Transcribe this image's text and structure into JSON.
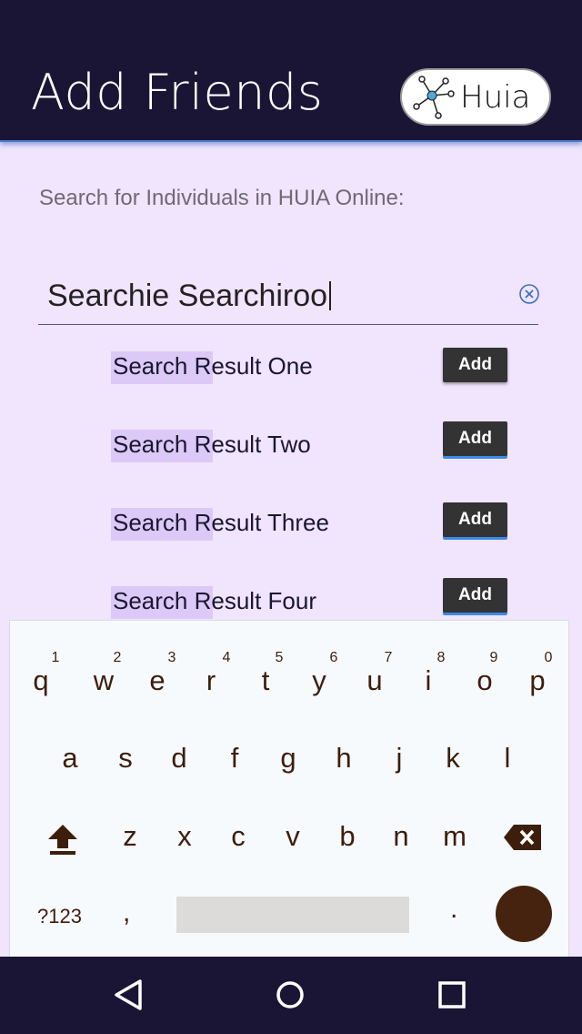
{
  "header": {
    "title": "Add Friends",
    "brand_name": "Huia"
  },
  "prompt": "Search for Individuals in HUIA Online:",
  "search": {
    "value": "Searchie Searchiroo"
  },
  "results": [
    {
      "highlight": "Search R",
      "label": "Search Result One",
      "button": "Add"
    },
    {
      "highlight": "Search R",
      "label": "Search Result Two",
      "button": "Add"
    },
    {
      "highlight": "Search R",
      "label": "Search Result Three",
      "button": "Add"
    },
    {
      "highlight": "Search R",
      "label": "Search Result Four",
      "button": "Add"
    }
  ],
  "keyboard": {
    "row1": [
      "q",
      "w",
      "e",
      "r",
      "t",
      "y",
      "u",
      "i",
      "o",
      "p"
    ],
    "row1_hints": [
      "1",
      "2",
      "3",
      "4",
      "5",
      "6",
      "7",
      "8",
      "9",
      "0"
    ],
    "row2": [
      "a",
      "s",
      "d",
      "f",
      "g",
      "h",
      "j",
      "k",
      "l"
    ],
    "row3": [
      "z",
      "x",
      "c",
      "v",
      "b",
      "n",
      "m"
    ],
    "symbols": "?123",
    "comma": ",",
    "period": "."
  },
  "colors": {
    "header_bg": "#1b1535",
    "page_bg": "#f1e4fd",
    "highlight": "#dcc9f7",
    "add_button": "#333333",
    "key_text": "#3d1e0c",
    "enter_key": "#46230e"
  },
  "icons": {
    "brand": "network-node-icon",
    "clear": "clear-circle-icon",
    "shift": "shift-icon",
    "backspace": "backspace-icon",
    "back": "back-triangle-icon",
    "home": "home-circle-icon",
    "recents": "recents-square-icon"
  }
}
